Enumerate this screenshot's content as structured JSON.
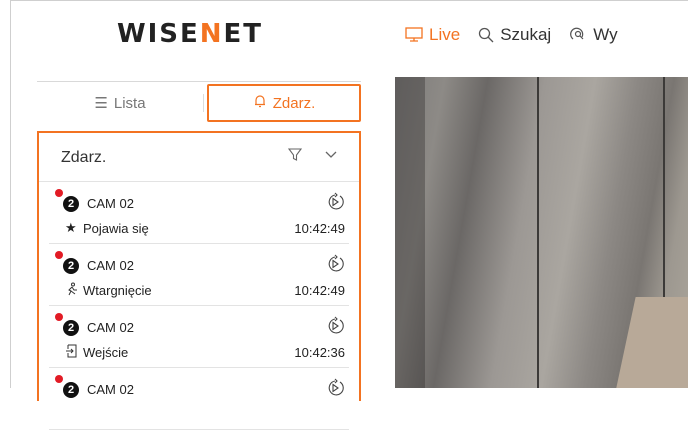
{
  "brand": {
    "logo_prefix": "WISE",
    "logo_accent": "N",
    "logo_suffix": "ET",
    "accent_color": "#f37321"
  },
  "topnav": {
    "live": "Live",
    "search": "Szukaj",
    "partial": "Wy"
  },
  "tabs": {
    "list": "Lista",
    "events": "Zdarz."
  },
  "panel": {
    "title": "Zdarz.",
    "filter_icon": "filter-icon",
    "collapse_icon": "chevron-down-icon"
  },
  "events": [
    {
      "badge": "2",
      "camera": "CAM 02",
      "icon": "star-icon",
      "type": "Pojawia się",
      "time": "10:42:49"
    },
    {
      "badge": "2",
      "camera": "CAM 02",
      "icon": "intrusion-icon",
      "type": "Wtargnięcie",
      "time": "10:42:49"
    },
    {
      "badge": "2",
      "camera": "CAM 02",
      "icon": "entry-icon",
      "type": "Wejście",
      "time": "10:42:36"
    },
    {
      "badge": "2",
      "camera": "CAM 02",
      "icon": "",
      "type": "",
      "time": ""
    }
  ]
}
